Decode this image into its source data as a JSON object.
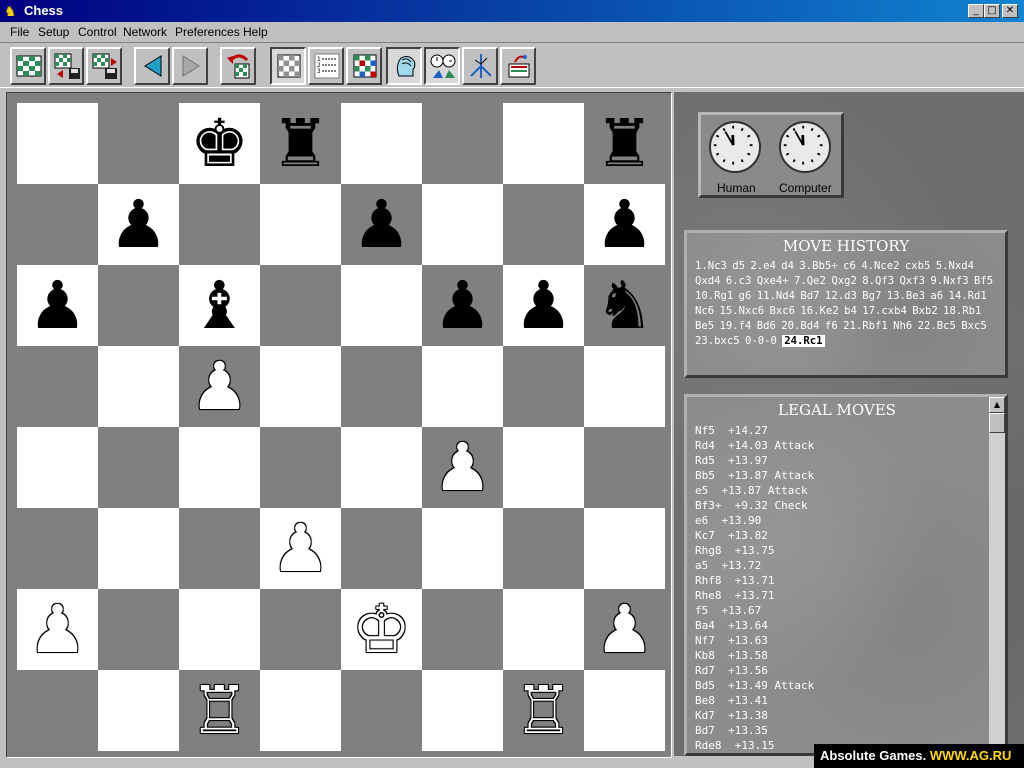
{
  "window": {
    "title": "Chess",
    "min_glyph": "_",
    "max_glyph": "□",
    "close_glyph": "✕"
  },
  "menu": [
    {
      "label": "File"
    },
    {
      "label": "Setup"
    },
    {
      "label": "Control"
    },
    {
      "label": "Network"
    },
    {
      "label": "Preferences"
    },
    {
      "label": "Help"
    }
  ],
  "toolbar": {
    "buttons": [
      {
        "icon": "new-game-icon"
      },
      {
        "icon": "load-game-icon"
      },
      {
        "icon": "save-game-icon"
      },
      {
        "icon": "back-arrow-icon"
      },
      {
        "icon": "forward-arrow-icon"
      },
      {
        "icon": "undo-move-icon"
      },
      {
        "icon": "board-icon"
      },
      {
        "icon": "notation-icon"
      },
      {
        "icon": "flip-board-icon"
      },
      {
        "icon": "hint-head-icon"
      },
      {
        "icon": "clocks-icon"
      },
      {
        "icon": "analysis-icon"
      },
      {
        "icon": "network-icon"
      }
    ]
  },
  "board": {
    "light_color": "#ffffff",
    "dark_color": "#808080",
    "pieces": [
      {
        "square": "c8",
        "color": "b",
        "glyph": "♚"
      },
      {
        "square": "d8",
        "color": "b",
        "glyph": "♜"
      },
      {
        "square": "h8",
        "color": "b",
        "glyph": "♜"
      },
      {
        "square": "b7",
        "color": "b",
        "glyph": "♟"
      },
      {
        "square": "e7",
        "color": "b",
        "glyph": "♟"
      },
      {
        "square": "h7",
        "color": "b",
        "glyph": "♟"
      },
      {
        "square": "a6",
        "color": "b",
        "glyph": "♟"
      },
      {
        "square": "c6",
        "color": "b",
        "glyph": "♝"
      },
      {
        "square": "f6",
        "color": "b",
        "glyph": "♟"
      },
      {
        "square": "g6",
        "color": "b",
        "glyph": "♟"
      },
      {
        "square": "h6",
        "color": "b",
        "glyph": "♞"
      },
      {
        "square": "c5",
        "color": "w",
        "glyph": "♟"
      },
      {
        "square": "f4",
        "color": "w",
        "glyph": "♟"
      },
      {
        "square": "d3",
        "color": "w",
        "glyph": "♟"
      },
      {
        "square": "a2",
        "color": "w",
        "glyph": "♟"
      },
      {
        "square": "e2",
        "color": "w",
        "glyph": "♔"
      },
      {
        "square": "h2",
        "color": "w",
        "glyph": "♟"
      },
      {
        "square": "c1",
        "color": "w",
        "glyph": "♖"
      },
      {
        "square": "g1",
        "color": "w",
        "glyph": "♖"
      }
    ]
  },
  "clocks": [
    {
      "label": "Human",
      "hour": 11,
      "minute": 55
    },
    {
      "label": "Computer",
      "hour": 11,
      "minute": 55
    }
  ],
  "move_history": {
    "title": "MOVE HISTORY",
    "text": "1.Nc3 d5 2.e4 d4 3.Bb5+ c6 4.Nce2 cxb5 5.Nxd4 Qxd4 6.c3 Qxe4+ 7.Qe2 Qxg2 8.Qf3 Qxf3 9.Nxf3 Bf5 10.Rg1 g6 11.Nd4 Bd7 12.d3 Bg7 13.Be3 a6 14.Rd1 Nc6 15.Nxc6 Bxc6 16.Ke2 b4 17.cxb4 Bxb2 18.Rb1 Be5 19.f4 Bd6 20.Bd4 f6 21.Rbf1 Nh6 22.Bc5 Bxc5 23.bxc5 0-0-0 ",
    "current": "24.Rc1"
  },
  "legal_moves": {
    "title": "LEGAL MOVES",
    "items": [
      "Nf5  +14.27",
      "Rd4  +14.03 Attack",
      "Rd5  +13.97",
      "Bb5  +13.87 Attack",
      "e5  +13.87 Attack",
      "Bf3+  +9.32 Check",
      "e6  +13.90",
      "Kc7  +13.82",
      "Rhg8  +13.75",
      "a5  +13.72",
      "Rhf8  +13.71",
      "Rhe8  +13.71",
      "f5  +13.67",
      "Ba4  +13.64",
      "Nf7  +13.63",
      "Kb8  +13.58",
      "Rd7  +13.56",
      "Bd5  +13.49 Attack",
      "Be8  +13.41",
      "Kd7  +13.38",
      "Bd7  +13.35",
      "Rde8  +13.15"
    ]
  },
  "watermark": {
    "left": "Absolute Games. ",
    "right": "WWW.AG.RU"
  }
}
